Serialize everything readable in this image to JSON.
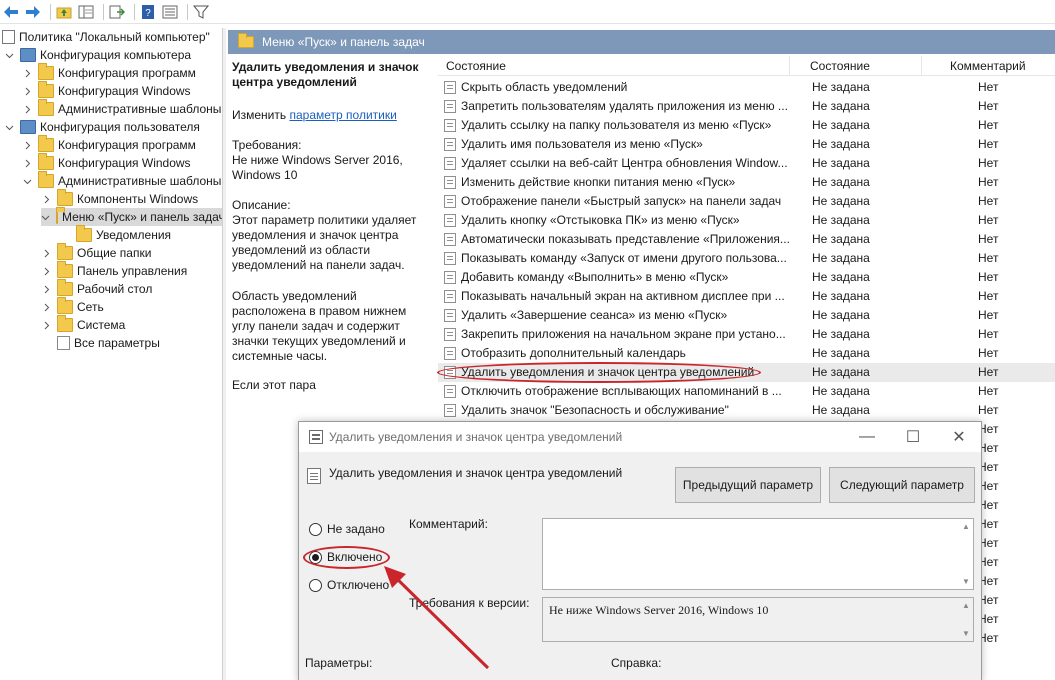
{
  "toolbar": {
    "icons": [
      "back-arrow-icon",
      "forward-arrow-icon",
      "up-folder-icon",
      "show-hide-tree-icon",
      "export-list-icon",
      "help-icon",
      "properties-icon",
      "filter-icon"
    ]
  },
  "tree": {
    "root": "Политика \"Локальный компьютер\"",
    "computer_config": "Конфигурация компьютера",
    "cc_programs": "Конфигурация программ",
    "cc_windows": "Конфигурация Windows",
    "cc_admin": "Административные шаблоны",
    "user_config": "Конфигурация пользователя",
    "uc_programs": "Конфигурация программ",
    "uc_windows": "Конфигурация Windows",
    "uc_admin": "Административные шаблоны",
    "win_components": "Компоненты Windows",
    "start_menu": "Меню «Пуск» и панель задач",
    "notifications": "Уведомления",
    "shared_folders": "Общие папки",
    "control_panel": "Панель управления",
    "desktop": "Рабочий стол",
    "network": "Сеть",
    "system": "Система",
    "all_settings": "Все параметры"
  },
  "right_header": {
    "title": "Меню «Пуск» и панель задач"
  },
  "description": {
    "title": "Удалить уведомления и значок центра уведомлений",
    "edit_prefix": "Изменить",
    "edit_link": "параметр политики",
    "req_label": "Требования:",
    "req_text": "Не ниже Windows Server 2016, Windows 10",
    "desc_label": "Описание:",
    "desc_text1": "Этот параметр политики удаляет уведомления и значок центра уведомлений из области уведомлений на панели задач.",
    "desc_text2": "Область уведомлений расположена в правом нижнем углу панели задач и содержит значки текущих уведомлений и системные часы.",
    "desc_text3": "Если этот пара"
  },
  "list": {
    "col_name": "Состояние",
    "col_state": "Состояние",
    "col_comment": "Комментарий",
    "rows": [
      {
        "name": "Скрыть область уведомлений",
        "state": "Не задана",
        "comment": "Нет"
      },
      {
        "name": "Запретить пользователям удалять приложения из меню ...",
        "state": "Не задана",
        "comment": "Нет"
      },
      {
        "name": "Удалить ссылку на папку пользователя из меню «Пуск»",
        "state": "Не задана",
        "comment": "Нет"
      },
      {
        "name": "Удалить имя пользователя из меню «Пуск»",
        "state": "Не задана",
        "comment": "Нет"
      },
      {
        "name": "Удаляет ссылки на веб-сайт Центра обновления Window...",
        "state": "Не задана",
        "comment": "Нет"
      },
      {
        "name": "Изменить действие кнопки питания меню «Пуск»",
        "state": "Не задана",
        "comment": "Нет"
      },
      {
        "name": "Отображение панели «Быстрый запуск» на панели задач",
        "state": "Не задана",
        "comment": "Нет"
      },
      {
        "name": "Удалить кнопку «Отстыковка ПК» из меню «Пуск»",
        "state": "Не задана",
        "comment": "Нет"
      },
      {
        "name": "Автоматически показывать представление «Приложения...",
        "state": "Не задана",
        "comment": "Нет"
      },
      {
        "name": "Показывать команду «Запуск от имени другого пользова...",
        "state": "Не задана",
        "comment": "Нет"
      },
      {
        "name": "Добавить команду «Выполнить» в меню «Пуск»",
        "state": "Не задана",
        "comment": "Нет"
      },
      {
        "name": "Показывать начальный экран на активном дисплее при ...",
        "state": "Не задана",
        "comment": "Нет"
      },
      {
        "name": "Удалить «Завершение сеанса» из меню «Пуск»",
        "state": "Не задана",
        "comment": "Нет"
      },
      {
        "name": "Закрепить приложения на начальном экране при устано...",
        "state": "Не задана",
        "comment": "Нет"
      },
      {
        "name": "Отобразить дополнительный календарь",
        "state": "Не задана",
        "comment": "Нет"
      },
      {
        "name": "Удалить уведомления и значок центра уведомлений",
        "state": "Не задана",
        "comment": "Нет"
      },
      {
        "name": "Отключить отображение всплывающих напоминаний в ...",
        "state": "Не задана",
        "comment": "Нет"
      },
      {
        "name": "Удалить значок \"Безопасность и обслуживание\"",
        "state": "Не задана",
        "comment": "Нет"
      },
      {
        "name": "",
        "state": "",
        "comment": "Нет"
      },
      {
        "name": "",
        "state": "",
        "comment": "Нет"
      },
      {
        "name": "",
        "state": "",
        "comment": "Нет"
      },
      {
        "name": "",
        "state": "",
        "comment": "Нет"
      },
      {
        "name": "",
        "state": "",
        "comment": "Нет"
      },
      {
        "name": "",
        "state": "",
        "comment": "Нет"
      },
      {
        "name": "",
        "state": "",
        "comment": "Нет"
      },
      {
        "name": "",
        "state": "",
        "comment": "Нет"
      },
      {
        "name": "",
        "state": "",
        "comment": "Нет"
      },
      {
        "name": "",
        "state": "",
        "comment": "Нет"
      },
      {
        "name": "",
        "state": "",
        "comment": "Нет"
      },
      {
        "name": "",
        "state": "",
        "comment": "Нет"
      }
    ]
  },
  "dialog": {
    "title": "Удалить уведомления и значок центра уведомлений",
    "heading": "Удалить уведомления и значок центра уведомлений",
    "prev_button": "Предыдущий параметр",
    "next_button": "Следующий параметр",
    "radio_not_configured": "Не задано",
    "radio_enabled": "Включено",
    "radio_disabled": "Отключено",
    "selected_option": "Включено",
    "comment_label": "Комментарий:",
    "comment_value": "",
    "req_label": "Требования к версии:",
    "req_value": "Не ниже Windows Server 2016, Windows 10",
    "params_label": "Параметры:",
    "help_label": "Справка:",
    "minimize_glyph": "—",
    "maximize_glyph": "☐",
    "close_glyph": "✕"
  },
  "colors": {
    "header_bar": "#7d98b8",
    "highlight_red": "#c9252b",
    "link": "#1b5fbf"
  }
}
